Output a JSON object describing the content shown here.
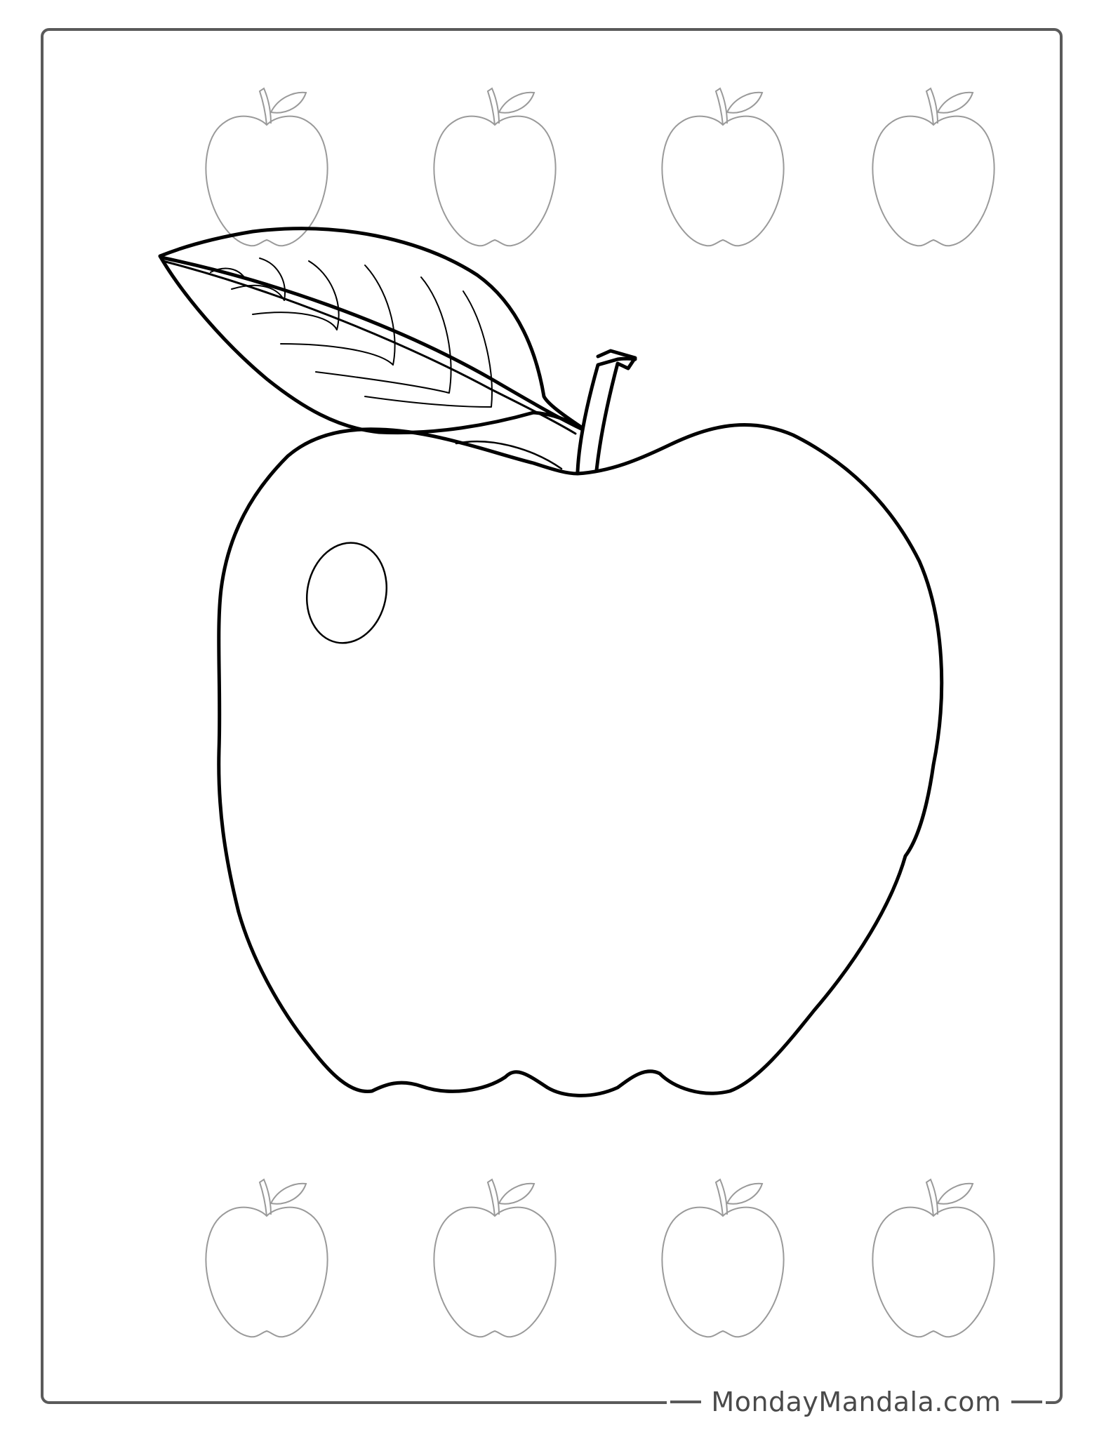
{
  "page": {
    "background_color": "#ffffff",
    "frame_color": "#5a5a5a"
  },
  "artwork": {
    "main_apple_outline_color": "#000000",
    "small_apples_outline_color": "#9a9a9a",
    "small_apples_top_row_count": 4,
    "small_apples_bottom_row_count": 4
  },
  "footer": {
    "brand": "MondayMandala.com"
  }
}
